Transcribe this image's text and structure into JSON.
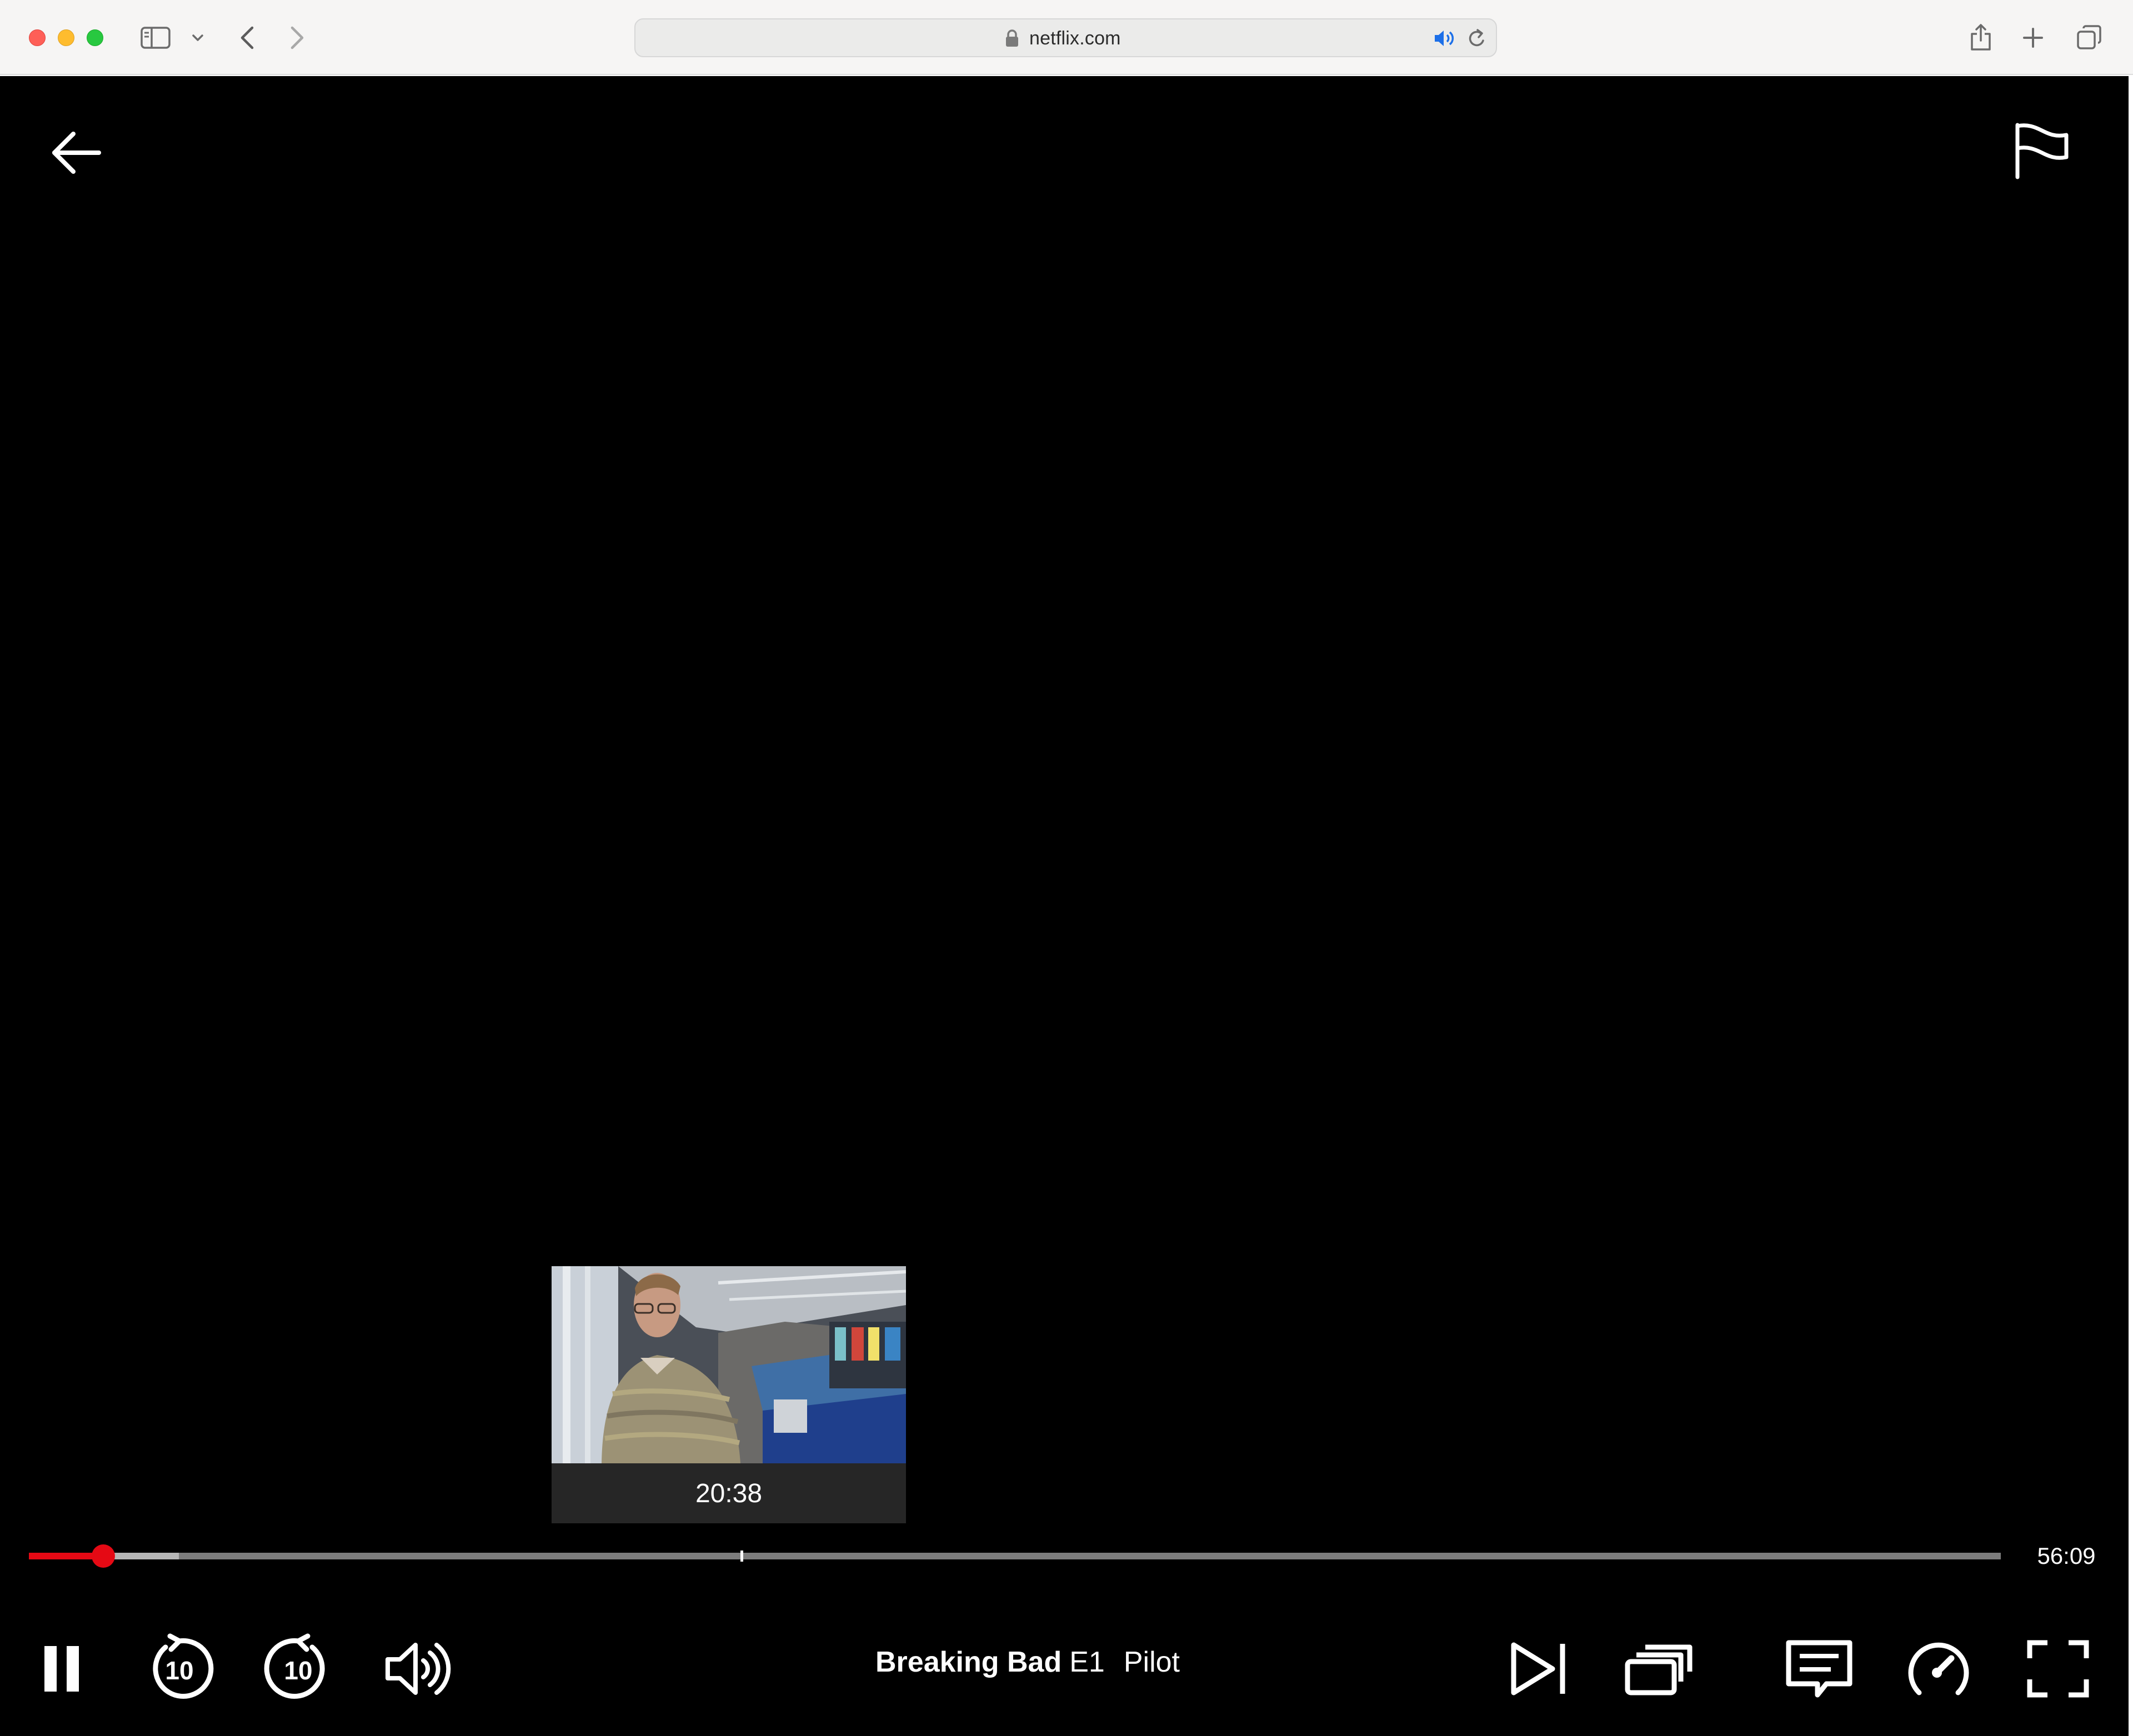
{
  "browser": {
    "url": "netflix.com",
    "icons": [
      "sidebar-icon",
      "chevron-down-icon",
      "back-icon",
      "forward-icon",
      "lock-icon",
      "speaker-icon",
      "reload-icon",
      "share-icon",
      "new-tab-icon",
      "tab-overview-icon"
    ]
  },
  "player": {
    "hover_preview": {
      "time": "20:38"
    },
    "progress": {
      "played_fraction": 0.0377,
      "buffered_fraction": 0.076,
      "hover_fraction": 0.3613
    },
    "time_remaining": "56:09",
    "title": {
      "show": "Breaking Bad",
      "episode": "E1",
      "name": "Pilot"
    },
    "controls": {
      "left": [
        "pause-icon",
        "rewind-10-icon",
        "forward-10-icon",
        "volume-icon"
      ],
      "right": [
        "next-episode-icon",
        "episodes-icon",
        "subtitles-icon",
        "playback-speed-icon",
        "fullscreen-icon"
      ],
      "rewind_seconds": "10",
      "forward_seconds": "10"
    },
    "top": [
      "back-arrow-icon",
      "report-flag-icon"
    ],
    "colors": {
      "accent": "#e50914",
      "background": "#000000",
      "track": "#7c7c7c",
      "buffered": "#b6b6b6"
    }
  }
}
